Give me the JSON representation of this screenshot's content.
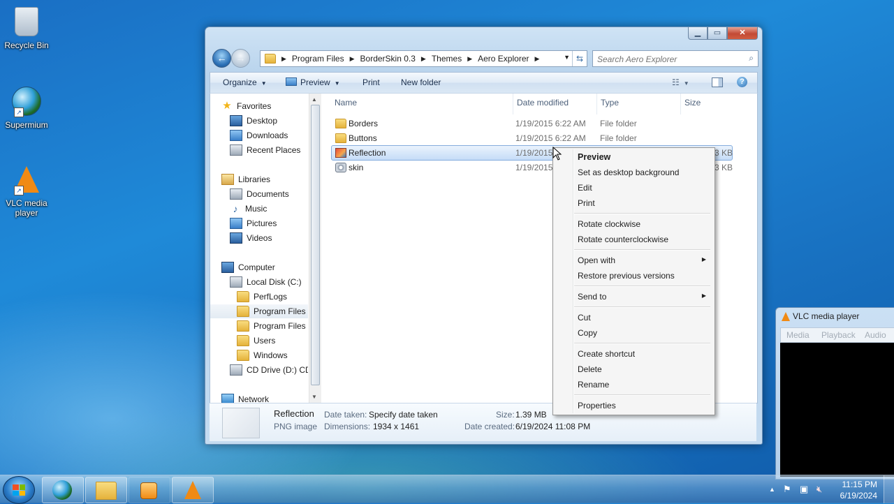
{
  "desktop": {
    "icons": [
      {
        "label": "Recycle Bin",
        "icon": "recycle-bin-icon"
      },
      {
        "label": "Supermium",
        "icon": "supermium-icon"
      },
      {
        "label": "VLC media player",
        "icon": "vlc-icon"
      }
    ]
  },
  "explorer": {
    "breadcrumb": [
      "Program Files",
      "BorderSkin 0.3",
      "Themes",
      "Aero Explorer"
    ],
    "search_placeholder": "Search Aero Explorer",
    "toolbar": {
      "organize": "Organize",
      "preview": "Preview",
      "print": "Print",
      "new_folder": "New folder"
    },
    "nav": {
      "favorites": "Favorites",
      "desktop": "Desktop",
      "downloads": "Downloads",
      "recent_places": "Recent Places",
      "libraries": "Libraries",
      "documents": "Documents",
      "music": "Music",
      "pictures": "Pictures",
      "videos": "Videos",
      "computer": "Computer",
      "local_disk": "Local Disk (C:)",
      "perflogs": "PerfLogs",
      "program_files": "Program Files",
      "program_files_x86": "Program Files (",
      "users": "Users",
      "windows": "Windows",
      "cd_drive": "CD Drive (D:) CDI",
      "network": "Network"
    },
    "columns": {
      "name": "Name",
      "date": "Date modified",
      "type": "Type",
      "size": "Size"
    },
    "files": [
      {
        "name": "Borders",
        "date": "1/19/2015 6:22 AM",
        "type": "File folder",
        "size": ""
      },
      {
        "name": "Buttons",
        "date": "1/19/2015 6:22 AM",
        "type": "File folder",
        "size": ""
      },
      {
        "name": "Reflection",
        "date": "1/19/2015",
        "type": "",
        "size": "3 KB"
      },
      {
        "name": "skin",
        "date": "1/19/2015",
        "type": "",
        "size": "3 KB"
      }
    ],
    "details": {
      "name": "Reflection",
      "kind": "PNG image",
      "date_taken_label": "Date taken:",
      "date_taken_value": "Specify date taken",
      "dimensions_label": "Dimensions:",
      "dimensions_value": "1934 x 1461",
      "size_label": "Size:",
      "size_value": "1.39 MB",
      "created_label": "Date created:",
      "created_value": "6/19/2024 11:08 PM"
    }
  },
  "context_menu": {
    "preview": "Preview",
    "set_bg": "Set as desktop background",
    "edit": "Edit",
    "print": "Print",
    "rotate_cw": "Rotate clockwise",
    "rotate_ccw": "Rotate counterclockwise",
    "open_with": "Open with",
    "restore": "Restore previous versions",
    "send_to": "Send to",
    "cut": "Cut",
    "copy": "Copy",
    "create_shortcut": "Create shortcut",
    "delete": "Delete",
    "rename": "Rename",
    "properties": "Properties"
  },
  "vlc": {
    "title": "VLC media player",
    "menu": [
      "Media",
      "Playback",
      "Audio"
    ]
  },
  "taskbar": {
    "time": "11:15 PM",
    "date": "6/19/2024"
  },
  "colors": {
    "accent": "#3399ff",
    "selection": "#c5dcf7",
    "close_button": "#c24a35"
  }
}
